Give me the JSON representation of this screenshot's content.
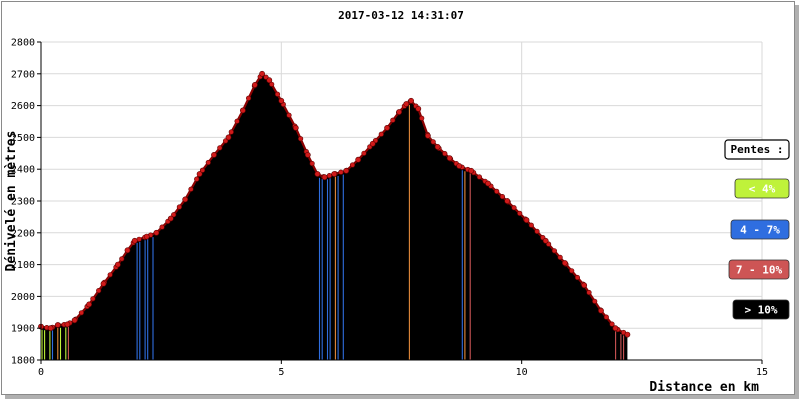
{
  "chart_data": {
    "type": "area",
    "title": "2017-03-12 14:31:07",
    "xlabel": "Distance en km",
    "ylabel": "Dénivelé en mètres",
    "xlim": [
      0,
      15
    ],
    "ylim": [
      1800,
      2800
    ],
    "x_ticks": [
      "0",
      "5",
      "10",
      "15"
    ],
    "y_ticks": [
      "1800",
      "1900",
      "2000",
      "2100",
      "2200",
      "2300",
      "2400",
      "2500",
      "2600",
      "2700",
      "2800"
    ],
    "grid": true,
    "profile": [
      [
        0.0,
        1905
      ],
      [
        0.2,
        1900
      ],
      [
        0.35,
        1910
      ],
      [
        0.55,
        1912
      ],
      [
        0.7,
        1925
      ],
      [
        1.0,
        1975
      ],
      [
        1.3,
        2040
      ],
      [
        1.6,
        2100
      ],
      [
        1.8,
        2145
      ],
      [
        1.95,
        2175
      ],
      [
        2.2,
        2188
      ],
      [
        2.4,
        2200
      ],
      [
        2.7,
        2245
      ],
      [
        3.0,
        2305
      ],
      [
        3.3,
        2385
      ],
      [
        3.6,
        2445
      ],
      [
        3.9,
        2500
      ],
      [
        4.2,
        2585
      ],
      [
        4.45,
        2665
      ],
      [
        4.6,
        2700
      ],
      [
        4.75,
        2680
      ],
      [
        5.0,
        2615
      ],
      [
        5.3,
        2530
      ],
      [
        5.55,
        2445
      ],
      [
        5.75,
        2385
      ],
      [
        5.9,
        2375
      ],
      [
        6.1,
        2385
      ],
      [
        6.35,
        2395
      ],
      [
        6.6,
        2430
      ],
      [
        6.9,
        2480
      ],
      [
        7.2,
        2530
      ],
      [
        7.45,
        2580
      ],
      [
        7.6,
        2605
      ],
      [
        7.7,
        2615
      ],
      [
        7.85,
        2590
      ],
      [
        8.05,
        2505
      ],
      [
        8.25,
        2470
      ],
      [
        8.5,
        2435
      ],
      [
        8.7,
        2410
      ],
      [
        8.95,
        2395
      ],
      [
        9.3,
        2355
      ],
      [
        9.7,
        2300
      ],
      [
        10.1,
        2240
      ],
      [
        10.5,
        2175
      ],
      [
        10.9,
        2105
      ],
      [
        11.3,
        2035
      ],
      [
        11.65,
        1955
      ],
      [
        11.95,
        1900
      ],
      [
        12.2,
        1880
      ]
    ],
    "legend": {
      "title": "Pentes :",
      "items": [
        {
          "label": "< 4%",
          "color": "#bff23a",
          "text_color": "#ffffff"
        },
        {
          "label": "4 - 7%",
          "color": "#2f6ee0",
          "text_color": "#ffffff"
        },
        {
          "label": "7 - 10%",
          "color": "#cd5555",
          "text_color": "#ffffff"
        },
        {
          "label": "> 10%",
          "color": "#000000",
          "text_color": "#ffffff"
        }
      ]
    },
    "colors": {
      "fill": "#000000",
      "line": "#8b0000",
      "marker": "#d01a1a",
      "grid": "#d9d9d9",
      "axis": "#000000"
    }
  }
}
